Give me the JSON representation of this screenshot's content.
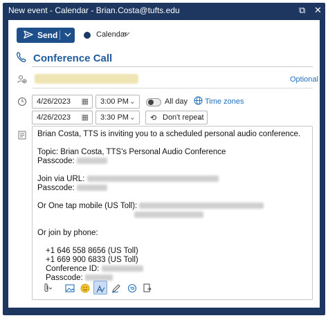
{
  "window": {
    "title": "New event - Calendar - Brian.Costa@tufts.edu",
    "icons": [
      "popout-icon",
      "close-icon"
    ]
  },
  "toolbar": {
    "send_label": "Send",
    "calendar_label": "Calendar",
    "calendar_color": "#1b3a66"
  },
  "event": {
    "title": "Conference Call",
    "optional_label": "Optional",
    "start_date": "4/26/2023",
    "start_time": "3:00 PM",
    "end_date": "4/26/2023",
    "end_time": "3:30 PM",
    "all_day_label": "All day",
    "time_zones_label": "Time zones",
    "repeat_label": "Don't repeat"
  },
  "body": {
    "intro": "Brian Costa, TTS is inviting you to a scheduled personal audio conference.",
    "topic": "Topic: Brian Costa, TTS's Personal Audio Conference",
    "passcode_label": "Passcode:",
    "join_url_label": "Join via URL:",
    "one_tap_label": "Or One tap mobile (US Toll):",
    "join_phone_label": "Or join by phone:",
    "phone_1": "+1 646 558 8656 (US Toll)",
    "phone_2": "+1 669 900 6833 (US Toll)",
    "conference_id_label": "Conference ID:"
  },
  "format_toolbar": {
    "icons": [
      "attach-icon",
      "image-icon",
      "emoji-icon",
      "format-painter-icon",
      "draw-icon",
      "loop-icon",
      "more-apps-icon"
    ]
  },
  "colors": {
    "accent": "#1f5b9c",
    "link": "#1f6fbf",
    "frame": "#1d3760",
    "send_button": "#1f4f8a"
  }
}
